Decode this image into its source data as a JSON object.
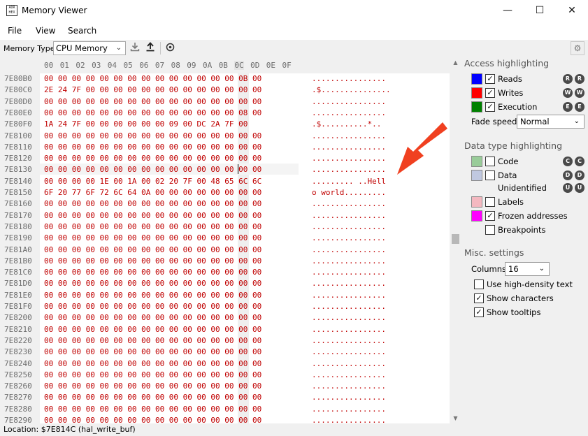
{
  "window": {
    "title": "Memory Viewer",
    "icon_text": "ADR\nHEX",
    "minimize": "—",
    "maximize": "☐",
    "close": "✕"
  },
  "menu": {
    "file": "File",
    "view": "View",
    "search": "Search"
  },
  "toolbar": {
    "memory_type_label": "Memory Type:",
    "memory_type_value": "CPU Memory",
    "download_icon": "download-icon",
    "upload_icon": "upload-icon",
    "refresh_icon": "refresh-icon",
    "settings_icon": "gear-icon"
  },
  "hex": {
    "columns": [
      "00",
      "01",
      "02",
      "03",
      "04",
      "05",
      "06",
      "07",
      "08",
      "09",
      "0A",
      "0B",
      "0C",
      "0D",
      "0E",
      "0F"
    ],
    "rows": [
      {
        "addr": "7E80B0",
        "bytes": "00 00 00 00 00 00 00 00 00 00 00 00 00 00 0B 00",
        "chars": "................"
      },
      {
        "addr": "7E80C0",
        "bytes": "2E 24 7F 00 00 00 00 00 00 00 00 00 00 00 00 00",
        "chars": ".$..............."
      },
      {
        "addr": "7E80D0",
        "bytes": "00 00 00 00 00 00 00 00 00 00 00 00 00 00 00 00",
        "chars": "................"
      },
      {
        "addr": "7E80E0",
        "bytes": "00 00 00 00 00 00 00 00 00 00 00 00 00 00 08 00",
        "chars": "................"
      },
      {
        "addr": "7E80F0",
        "bytes": "1A 24 7F 00 00 00 00 00 00 09 00 DC 2A 7F 00",
        "chars": ".$..........*.."
      },
      {
        "addr": "7E8100",
        "bytes": "00 00 00 00 00 00 00 00 00 00 00 00 00 00 00 00",
        "chars": "................"
      },
      {
        "addr": "7E8110",
        "bytes": "00 00 00 00 00 00 00 00 00 00 00 00 00 00 00 00",
        "chars": "................"
      },
      {
        "addr": "7E8120",
        "bytes": "00 00 00 00 00 00 00 00 00 00 00 00 00 00 00 00",
        "chars": "................"
      },
      {
        "addr": "7E8130",
        "bytes": "00 00 00 00 00 00 00 00 00 00 00 00 00 00 00 00",
        "chars": "................"
      },
      {
        "addr": "7E8140",
        "bytes": "00 00 00 00 1E 00 1A 00 02 20 7F 00 48 65 6C 6C",
        "chars": "......... ..Hell"
      },
      {
        "addr": "7E8150",
        "bytes": "6F 20 77 6F 72 6C 64 0A 00 00 00 00 00 00 00 00",
        "chars": "o world........."
      },
      {
        "addr": "7E8160",
        "bytes": "00 00 00 00 00 00 00 00 00 00 00 00 00 00 00 00",
        "chars": "................"
      },
      {
        "addr": "7E8170",
        "bytes": "00 00 00 00 00 00 00 00 00 00 00 00 00 00 00 00",
        "chars": "................"
      },
      {
        "addr": "7E8180",
        "bytes": "00 00 00 00 00 00 00 00 00 00 00 00 00 00 00 00",
        "chars": "................"
      },
      {
        "addr": "7E8190",
        "bytes": "00 00 00 00 00 00 00 00 00 00 00 00 00 00 00 00",
        "chars": "................"
      },
      {
        "addr": "7E81A0",
        "bytes": "00 00 00 00 00 00 00 00 00 00 00 00 00 00 00 00",
        "chars": "................"
      },
      {
        "addr": "7E81B0",
        "bytes": "00 00 00 00 00 00 00 00 00 00 00 00 00 00 00 00",
        "chars": "................"
      },
      {
        "addr": "7E81C0",
        "bytes": "00 00 00 00 00 00 00 00 00 00 00 00 00 00 00 00",
        "chars": "................"
      },
      {
        "addr": "7E81D0",
        "bytes": "00 00 00 00 00 00 00 00 00 00 00 00 00 00 00 00",
        "chars": "................"
      },
      {
        "addr": "7E81E0",
        "bytes": "00 00 00 00 00 00 00 00 00 00 00 00 00 00 00 00",
        "chars": "................"
      },
      {
        "addr": "7E81F0",
        "bytes": "00 00 00 00 00 00 00 00 00 00 00 00 00 00 00 00",
        "chars": "................"
      },
      {
        "addr": "7E8200",
        "bytes": "00 00 00 00 00 00 00 00 00 00 00 00 00 00 00 00",
        "chars": "................"
      },
      {
        "addr": "7E8210",
        "bytes": "00 00 00 00 00 00 00 00 00 00 00 00 00 00 00 00",
        "chars": "................"
      },
      {
        "addr": "7E8220",
        "bytes": "00 00 00 00 00 00 00 00 00 00 00 00 00 00 00 00",
        "chars": "................"
      },
      {
        "addr": "7E8230",
        "bytes": "00 00 00 00 00 00 00 00 00 00 00 00 00 00 00 00",
        "chars": "................"
      },
      {
        "addr": "7E8240",
        "bytes": "00 00 00 00 00 00 00 00 00 00 00 00 00 00 00 00",
        "chars": "................"
      },
      {
        "addr": "7E8250",
        "bytes": "00 00 00 00 00 00 00 00 00 00 00 00 00 00 00 00",
        "chars": "................"
      },
      {
        "addr": "7E8260",
        "bytes": "00 00 00 00 00 00 00 00 00 00 00 00 00 00 00 00",
        "chars": "................"
      },
      {
        "addr": "7E8270",
        "bytes": "00 00 00 00 00 00 00 00 00 00 00 00 00 00 00 00",
        "chars": "................"
      },
      {
        "addr": "7E8280",
        "bytes": "00 00 00 00 00 00 00 00 00 00 00 00 00 00 00 00",
        "chars": "................"
      },
      {
        "addr": "7E8290",
        "bytes": "00 00 00 00 00 00 00 00 00 00 00 00 00 00 00 00",
        "chars": "................"
      }
    ]
  },
  "status": {
    "location": "Location: $7E814C (hal_write_buf)"
  },
  "side": {
    "access_title": "Access highlighting",
    "reads": {
      "label": "Reads",
      "color": "#0000ff",
      "badge1": "R",
      "badge2": "R",
      "checked": true
    },
    "writes": {
      "label": "Writes",
      "color": "#ff0000",
      "badge1": "W",
      "badge2": "W",
      "checked": true
    },
    "execution": {
      "label": "Execution",
      "color": "#008000",
      "badge1": "E",
      "badge2": "E",
      "checked": true
    },
    "fade_label": "Fade speed:",
    "fade_value": "Normal",
    "datatype_title": "Data type highlighting",
    "code": {
      "label": "Code",
      "color": "#99cc99",
      "badge1": "C",
      "badge2": "C",
      "checked": false
    },
    "data": {
      "label": "Data",
      "color": "#c0c8e0",
      "badge1": "D",
      "badge2": "D",
      "checked": false
    },
    "unidentified": {
      "label": "Unidentified",
      "badge1": "U",
      "badge2": "U"
    },
    "labels": {
      "label": "Labels",
      "color": "#f4b8c0",
      "checked": false
    },
    "frozen": {
      "label": "Frozen addresses",
      "color": "#ff00ff",
      "checked": true
    },
    "breakpoints": {
      "label": "Breakpoints",
      "checked": false
    },
    "misc_title": "Misc. settings",
    "columns_label": "Columns:",
    "columns_value": "16",
    "high_density": {
      "label": "Use high-density text",
      "checked": false
    },
    "show_chars": {
      "label": "Show characters",
      "checked": true
    },
    "show_tooltips": {
      "label": "Show tooltips",
      "checked": true
    }
  },
  "annotation": {
    "arrow_color": "#f04020"
  }
}
